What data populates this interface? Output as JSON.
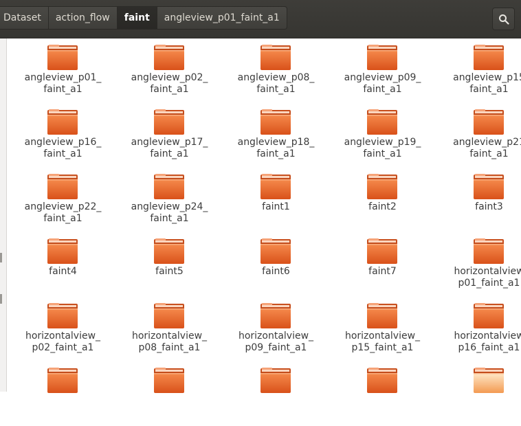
{
  "breadcrumb": {
    "items": [
      "Dataset",
      "action_flow",
      "faint",
      "angleview_p01_faint_a1"
    ],
    "active_index": 2
  },
  "search": {
    "icon": "search-icon"
  },
  "colors": {
    "toolbar": "#3c3b37",
    "folder_top": "#f47a3c",
    "folder_bottom": "#d9531b",
    "folder_tab": "#f6a378",
    "text": "#3c3c3c"
  },
  "files": {
    "items": [
      {
        "line1": "angleview_p01_",
        "line2": "faint_a1"
      },
      {
        "line1": "angleview_p02_",
        "line2": "faint_a1"
      },
      {
        "line1": "angleview_p08_",
        "line2": "faint_a1"
      },
      {
        "line1": "angleview_p09_",
        "line2": "faint_a1"
      },
      {
        "line1": "angleview_p15",
        "line2": "faint_a1"
      },
      {
        "line1": "angleview_p16_",
        "line2": "faint_a1"
      },
      {
        "line1": "angleview_p17_",
        "line2": "faint_a1"
      },
      {
        "line1": "angleview_p18_",
        "line2": "faint_a1"
      },
      {
        "line1": "angleview_p19_",
        "line2": "faint_a1"
      },
      {
        "line1": "angleview_p21",
        "line2": "faint_a1"
      },
      {
        "line1": "angleview_p22_",
        "line2": "faint_a1"
      },
      {
        "line1": "angleview_p24_",
        "line2": "faint_a1"
      },
      {
        "line1": "faint1",
        "line2": ""
      },
      {
        "line1": "faint2",
        "line2": ""
      },
      {
        "line1": "faint3",
        "line2": ""
      },
      {
        "line1": "faint4",
        "line2": ""
      },
      {
        "line1": "faint5",
        "line2": ""
      },
      {
        "line1": "faint6",
        "line2": ""
      },
      {
        "line1": "faint7",
        "line2": ""
      },
      {
        "line1": "horizontalview",
        "line2": "p01_faint_a1"
      },
      {
        "line1": "horizontalview_",
        "line2": "p02_faint_a1"
      },
      {
        "line1": "horizontalview_",
        "line2": "p08_faint_a1"
      },
      {
        "line1": "horizontalview_",
        "line2": "p09_faint_a1"
      },
      {
        "line1": "horizontalview_",
        "line2": "p15_faint_a1"
      },
      {
        "line1": "horizontalview",
        "line2": "p16_faint_a1"
      },
      {
        "line1": "",
        "line2": ""
      },
      {
        "line1": "",
        "line2": ""
      },
      {
        "line1": "",
        "line2": ""
      },
      {
        "line1": "",
        "line2": ""
      },
      {
        "line1": "",
        "line2": ""
      }
    ]
  }
}
